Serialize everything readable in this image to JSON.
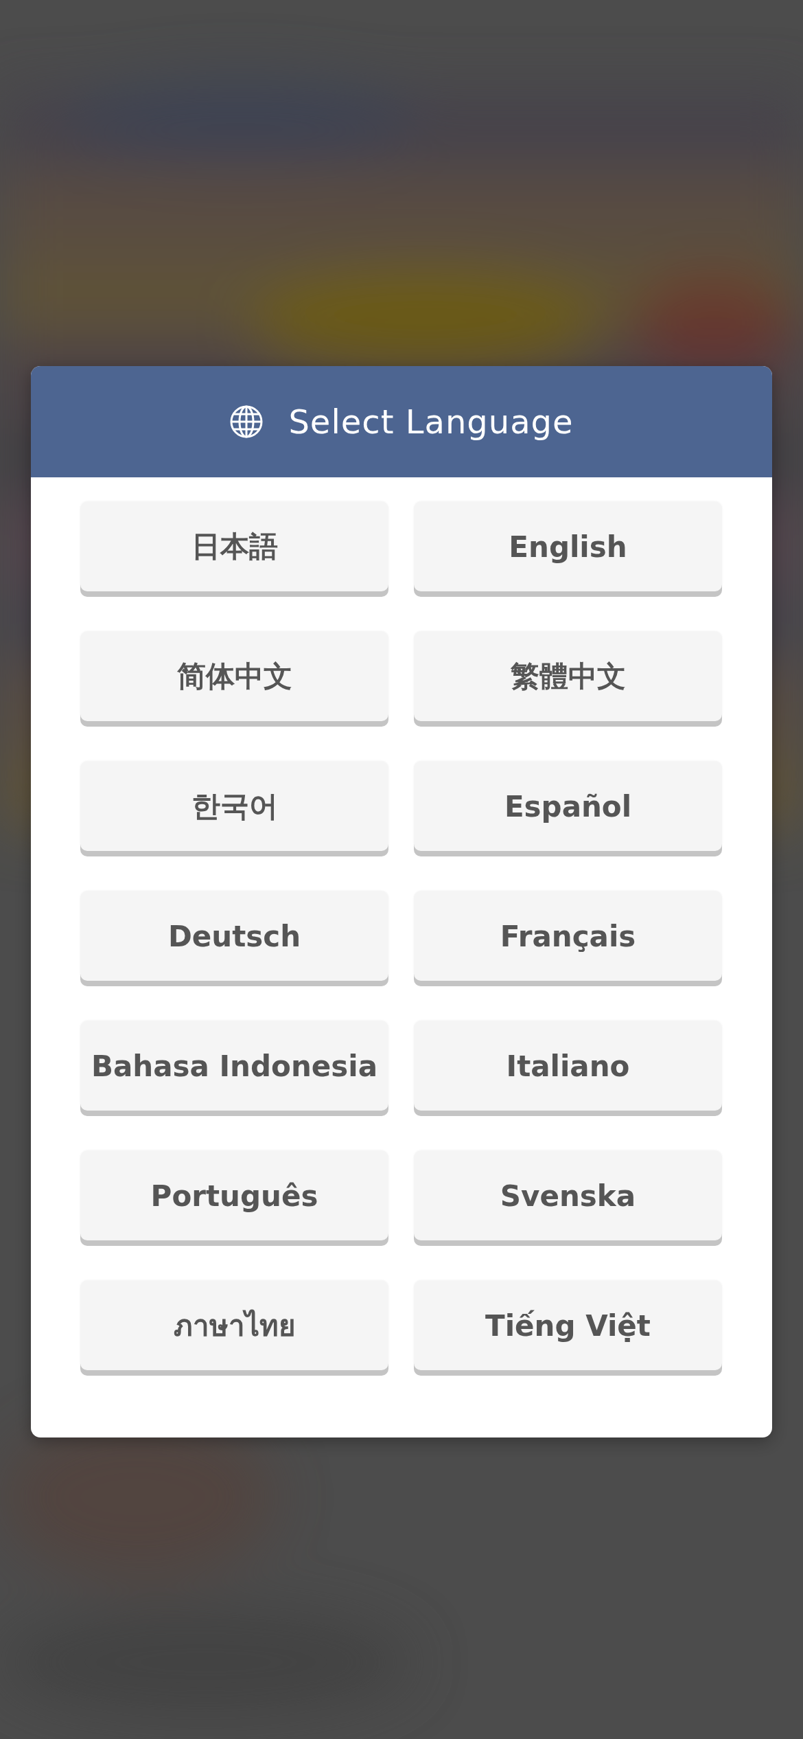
{
  "dialog": {
    "title": "Select Language",
    "languages": [
      {
        "label": "日本語"
      },
      {
        "label": "English"
      },
      {
        "label": "简体中文"
      },
      {
        "label": "繁體中文"
      },
      {
        "label": "한국어"
      },
      {
        "label": "Español"
      },
      {
        "label": "Deutsch"
      },
      {
        "label": "Français"
      },
      {
        "label": "Bahasa Indonesia"
      },
      {
        "label": "Italiano"
      },
      {
        "label": "Português"
      },
      {
        "label": "Svenska"
      },
      {
        "label": "ภาษาไทย"
      },
      {
        "label": "Tiếng Việt"
      }
    ]
  }
}
